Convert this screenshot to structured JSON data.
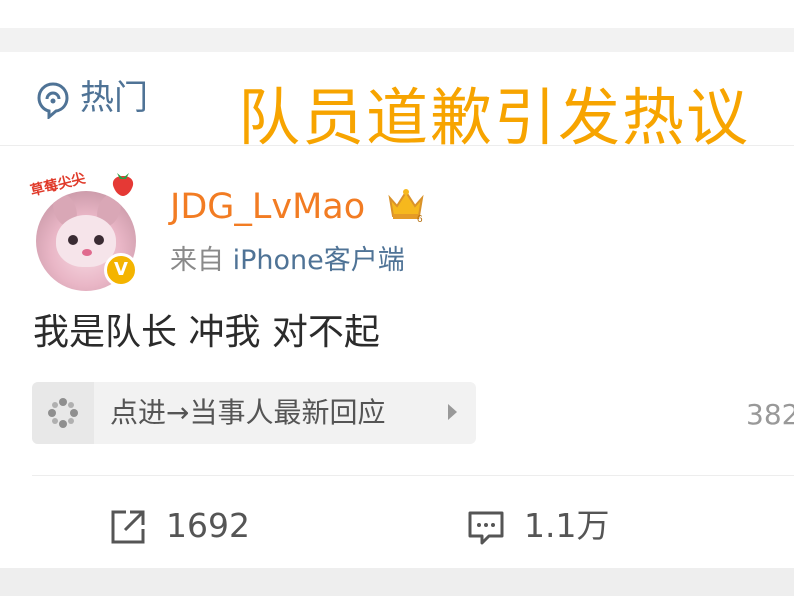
{
  "section": {
    "hot_label": "热门",
    "icon": "hot-topic-icon"
  },
  "overlay": {
    "title": "队员道歉引发热议",
    "color": "#f7a400"
  },
  "post": {
    "avatar_text": "草莓尖尖",
    "username": "JDG_LvMao",
    "username_color": "#f27c23",
    "verified_mark": "V",
    "source_prefix": "来自 ",
    "source_app": "iPhone客户端",
    "text": "我是队长 冲我 对不起",
    "link_label": "点进→当事人最新回应",
    "right_count": "382",
    "share_count": "1692",
    "comment_count": "1.1万"
  },
  "icons": {
    "hot": "hot-topic-icon",
    "crown": "member-crown-icon",
    "link": "link-card-icon",
    "share": "share-icon",
    "comment": "comment-icon"
  }
}
